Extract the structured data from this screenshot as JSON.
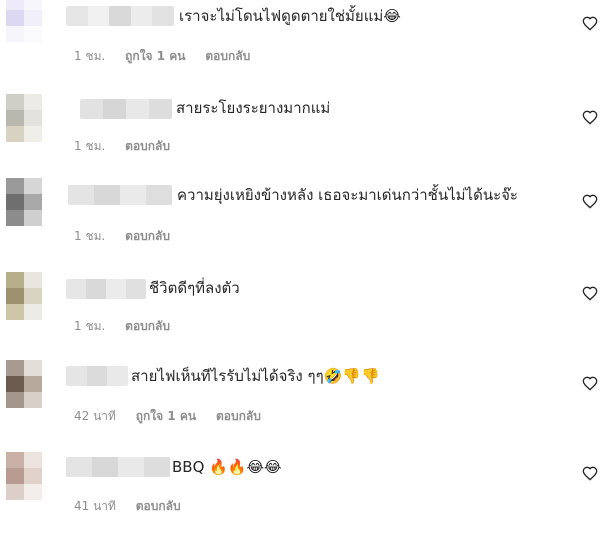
{
  "icons": {
    "like": "heart-outline-icon"
  },
  "colors": {
    "meta": "#8e8e8e",
    "text": "#262626"
  },
  "comments": [
    {
      "text": "เราจะไม่โดนไฟดูดตายใช่มั้ยแม่😂",
      "time": "1 ชม.",
      "likes": "ถูกใจ 1 คน",
      "reply": "ตอบกลับ"
    },
    {
      "text": "สายระโยงระยางมากแม่",
      "time": "1 ชม.",
      "likes": "",
      "reply": "ตอบกลับ"
    },
    {
      "text": "ความยุ่งเหยิงข้างหลัง เธอจะมาเด่นกว่าชั้นไม่ได้นะจ๊ะ",
      "time": "1 ชม.",
      "likes": "",
      "reply": "ตอบกลับ"
    },
    {
      "text": "ชีวิตดีๆที่ลงตัว",
      "time": "1 ชม.",
      "likes": "",
      "reply": "ตอบกลับ"
    },
    {
      "text": "สายไฟเห็นทีไรรับไม่ได้จริง ๆๆ🤣👎👎",
      "time": "42 นาที",
      "likes": "ถูกใจ 1 คน",
      "reply": "ตอบกลับ"
    },
    {
      "text": "BBQ 🔥🔥😂😂",
      "time": "41 นาที",
      "likes": "",
      "reply": "ตอบกลับ"
    }
  ]
}
